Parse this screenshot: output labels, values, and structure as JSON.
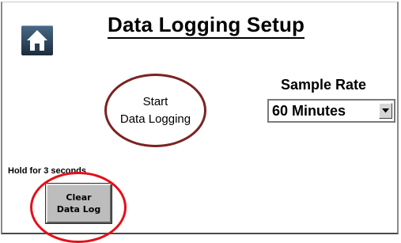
{
  "header": {
    "title": "Data Logging Setup",
    "home_icon": "home-icon"
  },
  "logging": {
    "start_line1": "Start",
    "start_line2": "Data Logging"
  },
  "sample_rate": {
    "label": "Sample Rate",
    "selected": "60 Minutes",
    "arrow_icon": "chevron-down-icon"
  },
  "clear_log": {
    "hint": "Hold for 3 seconds",
    "line1": "Clear",
    "line2": "Data Log"
  },
  "colors": {
    "start_ring": "#7a2323",
    "highlight_ring": "#e3101a",
    "button_face": "#bdbdbd"
  }
}
